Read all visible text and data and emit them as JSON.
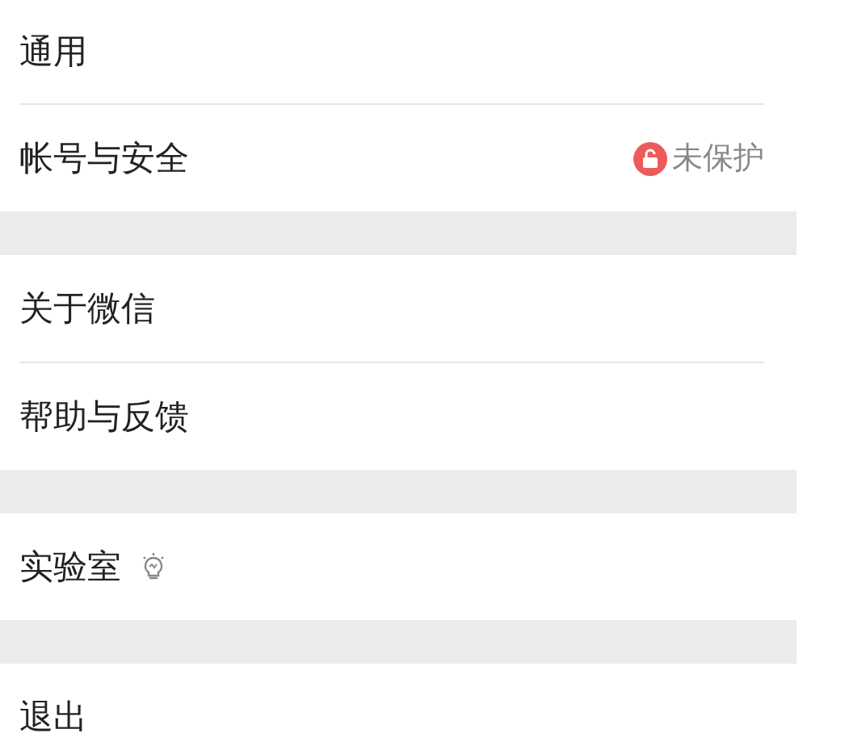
{
  "groups": [
    {
      "items": [
        {
          "kind": "plain",
          "label": "通用"
        },
        {
          "kind": "status",
          "label": "帐号与安全",
          "status": "未保护"
        }
      ]
    },
    {
      "items": [
        {
          "kind": "plain",
          "label": "关于微信"
        },
        {
          "kind": "plain",
          "label": "帮助与反馈"
        }
      ]
    },
    {
      "items": [
        {
          "kind": "lab",
          "label": "实验室"
        }
      ]
    },
    {
      "items": [
        {
          "kind": "plain",
          "label": "退出"
        }
      ]
    }
  ]
}
